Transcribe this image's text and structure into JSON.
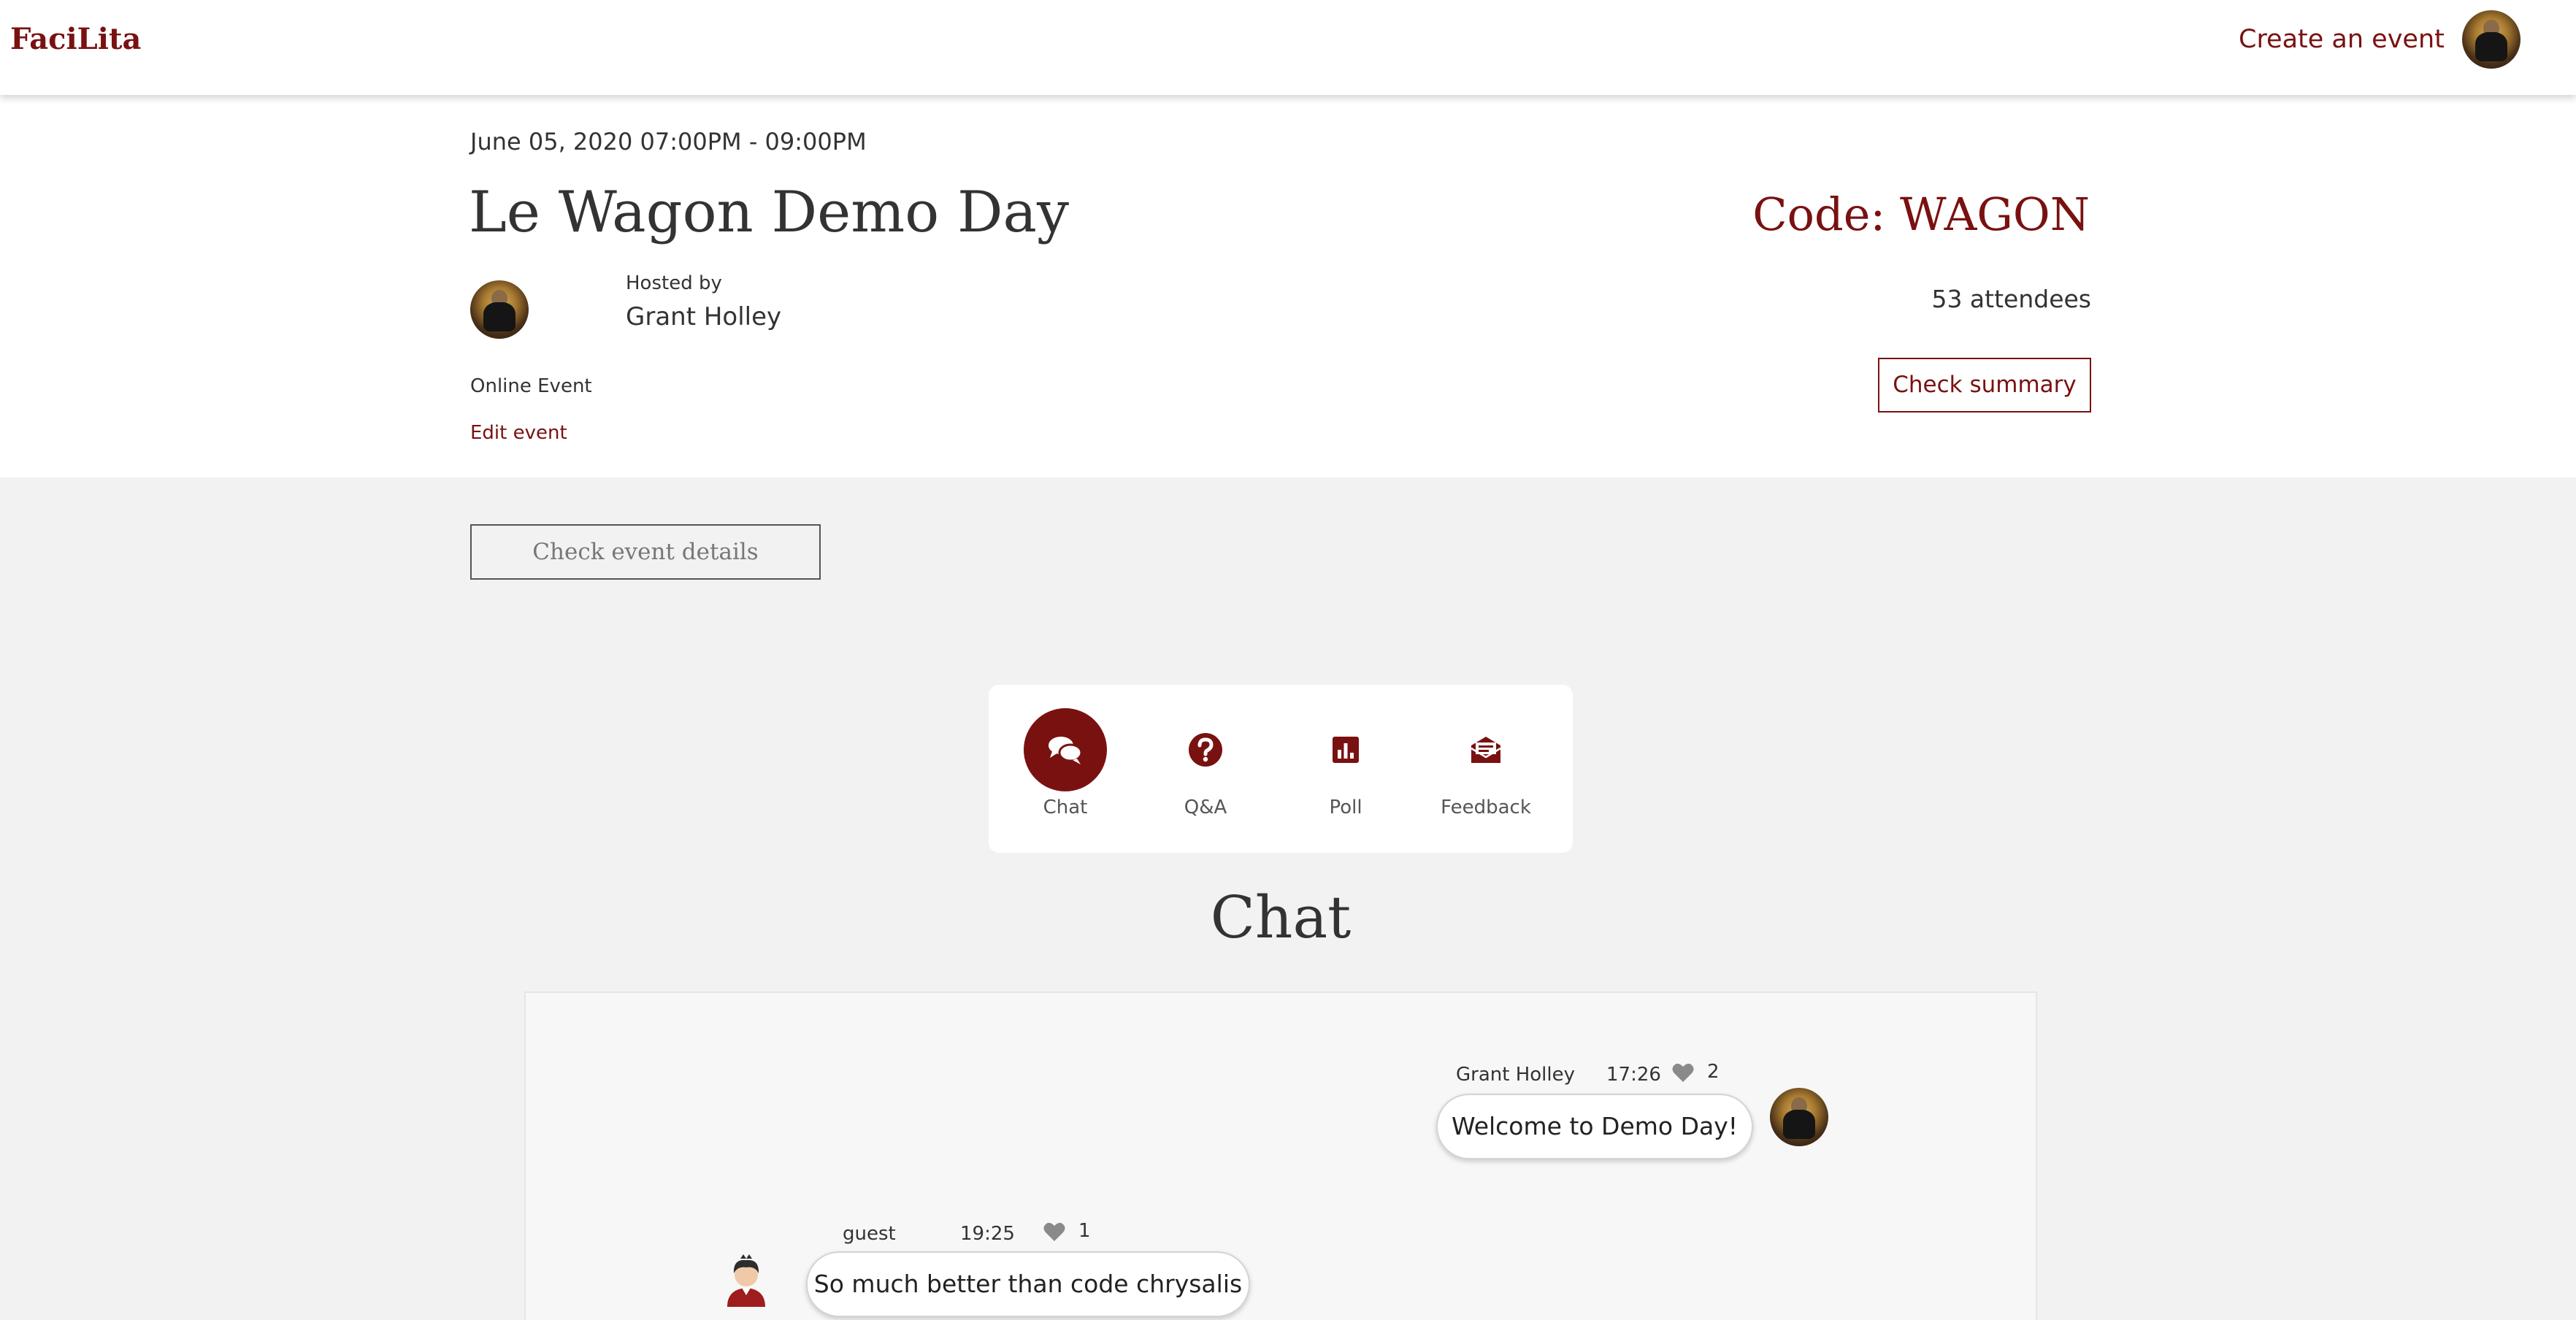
{
  "navbar": {
    "brand": "FaciLita",
    "create_event": "Create an event"
  },
  "event": {
    "date": "June 05, 2020 07:00PM - 09:00PM",
    "title": "Le Wagon Demo Day",
    "code": "Code: WAGON",
    "hosted_by_label": "Hosted by",
    "host_name": "Grant Holley",
    "attendees": "53 attendees",
    "location": "Online Event",
    "edit_link": "Edit event",
    "summary_button": "Check summary"
  },
  "details_button": "Check event details",
  "tabs": [
    {
      "label": "Chat",
      "icon": "chat-icon",
      "active": true
    },
    {
      "label": "Q&A",
      "icon": "question-icon",
      "active": false
    },
    {
      "label": "Poll",
      "icon": "poll-icon",
      "active": false
    },
    {
      "label": "Feedback",
      "icon": "feedback-icon",
      "active": false
    }
  ],
  "section_title": "Chat",
  "messages": [
    {
      "author": "Grant Holley",
      "time": "17:26",
      "likes": "2",
      "text": "Welcome to Demo Day!",
      "side": "right"
    },
    {
      "author": "guest",
      "time": "19:25",
      "likes": "1",
      "text": "So much better than code chrysalis",
      "side": "left"
    }
  ],
  "colors": {
    "accent": "#7a1111",
    "background": "#f2f2f2",
    "panel": "#ffffff"
  }
}
